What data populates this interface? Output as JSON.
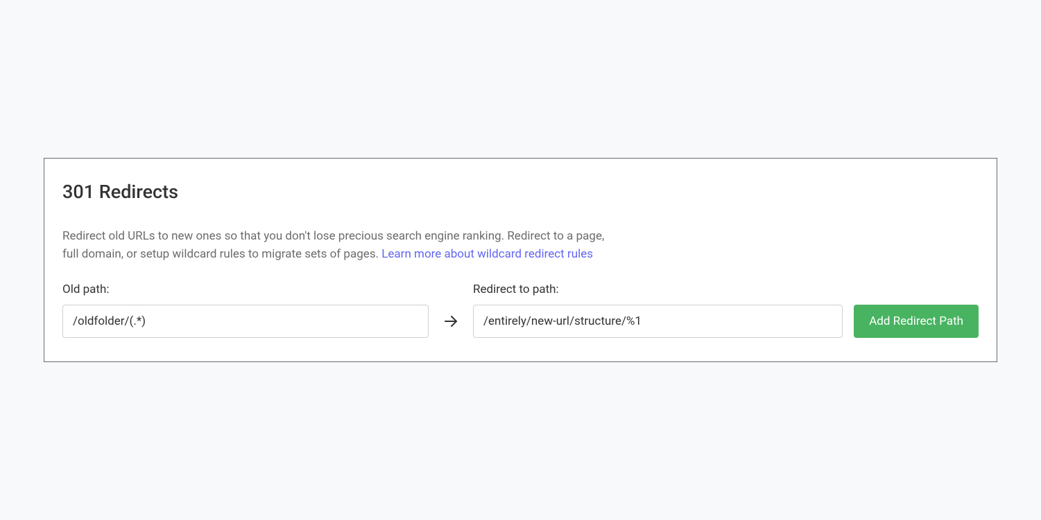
{
  "panel": {
    "title": "301 Redirects",
    "description_text": "Redirect old URLs to new ones so that you don't lose precious search engine ranking. Redirect to a page, full domain, or setup wildcard rules to migrate sets of pages. ",
    "description_link": "Learn more about wildcard redirect rules"
  },
  "form": {
    "old_path": {
      "label": "Old path:",
      "value": "/oldfolder/(.*)"
    },
    "redirect_to": {
      "label": "Redirect to path:",
      "value": "/entirely/new-url/structure/%1"
    },
    "button_label": "Add Redirect Path"
  }
}
